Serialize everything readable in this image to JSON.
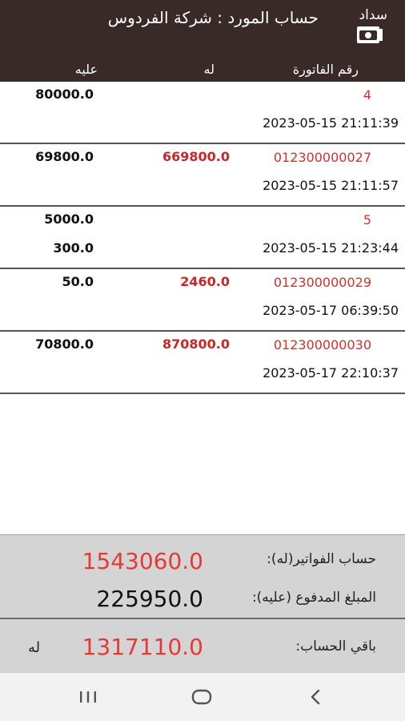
{
  "header": {
    "title": "حساب المورد : شركة الفردوس",
    "pay_label": "سداد",
    "background": "#3a2a27"
  },
  "columns": {
    "invoice_no": "رقم الفاتورة",
    "credit": "له",
    "debit": "عليه"
  },
  "rows": [
    {
      "invoice": "4",
      "date": "2023-05-15 21:11:39",
      "credit": "",
      "debit": "80000.0",
      "debit2": ""
    },
    {
      "invoice": "012300000027",
      "date": "2023-05-15 21:11:57",
      "credit": "669800.0",
      "debit": "69800.0",
      "debit2": ""
    },
    {
      "invoice": "5",
      "date": "2023-05-15 21:23:44",
      "credit": "",
      "debit": "5000.0",
      "debit2": "300.0"
    },
    {
      "invoice": "012300000029",
      "date": "2023-05-17 06:39:50",
      "credit": "2460.0",
      "debit": "50.0",
      "debit2": ""
    },
    {
      "invoice": "012300000030",
      "date": "2023-05-17 22:10:37",
      "credit": "870800.0",
      "debit": "70800.0",
      "debit2": ""
    }
  ],
  "summary": {
    "invoices_label": "حساب الفواتير(له):",
    "invoices_value": "1543060.0",
    "paid_label": "المبلغ المدفوع (عليه):",
    "paid_value": "225950.0",
    "balance_label": "باقي الحساب:",
    "balance_value": "1317110.0",
    "balance_unit": "له"
  },
  "colors": {
    "accent_red": "#e53935",
    "summary_bg": "#d4d4d4"
  },
  "navbar": {
    "recent_icon": "recent-apps-icon",
    "home_icon": "home-icon",
    "back_icon": "back-icon"
  }
}
